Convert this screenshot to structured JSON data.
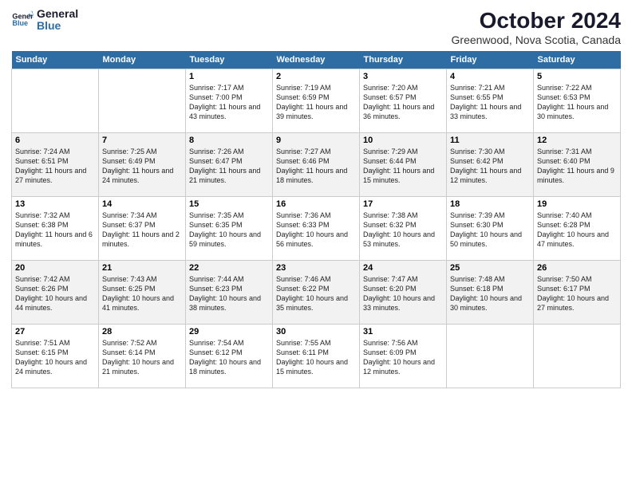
{
  "header": {
    "logo_line1": "General",
    "logo_line2": "Blue",
    "month": "October 2024",
    "location": "Greenwood, Nova Scotia, Canada"
  },
  "weekdays": [
    "Sunday",
    "Monday",
    "Tuesday",
    "Wednesday",
    "Thursday",
    "Friday",
    "Saturday"
  ],
  "weeks": [
    [
      {
        "day": "",
        "info": ""
      },
      {
        "day": "",
        "info": ""
      },
      {
        "day": "1",
        "info": "Sunrise: 7:17 AM\nSunset: 7:00 PM\nDaylight: 11 hours and 43 minutes."
      },
      {
        "day": "2",
        "info": "Sunrise: 7:19 AM\nSunset: 6:59 PM\nDaylight: 11 hours and 39 minutes."
      },
      {
        "day": "3",
        "info": "Sunrise: 7:20 AM\nSunset: 6:57 PM\nDaylight: 11 hours and 36 minutes."
      },
      {
        "day": "4",
        "info": "Sunrise: 7:21 AM\nSunset: 6:55 PM\nDaylight: 11 hours and 33 minutes."
      },
      {
        "day": "5",
        "info": "Sunrise: 7:22 AM\nSunset: 6:53 PM\nDaylight: 11 hours and 30 minutes."
      }
    ],
    [
      {
        "day": "6",
        "info": "Sunrise: 7:24 AM\nSunset: 6:51 PM\nDaylight: 11 hours and 27 minutes."
      },
      {
        "day": "7",
        "info": "Sunrise: 7:25 AM\nSunset: 6:49 PM\nDaylight: 11 hours and 24 minutes."
      },
      {
        "day": "8",
        "info": "Sunrise: 7:26 AM\nSunset: 6:47 PM\nDaylight: 11 hours and 21 minutes."
      },
      {
        "day": "9",
        "info": "Sunrise: 7:27 AM\nSunset: 6:46 PM\nDaylight: 11 hours and 18 minutes."
      },
      {
        "day": "10",
        "info": "Sunrise: 7:29 AM\nSunset: 6:44 PM\nDaylight: 11 hours and 15 minutes."
      },
      {
        "day": "11",
        "info": "Sunrise: 7:30 AM\nSunset: 6:42 PM\nDaylight: 11 hours and 12 minutes."
      },
      {
        "day": "12",
        "info": "Sunrise: 7:31 AM\nSunset: 6:40 PM\nDaylight: 11 hours and 9 minutes."
      }
    ],
    [
      {
        "day": "13",
        "info": "Sunrise: 7:32 AM\nSunset: 6:38 PM\nDaylight: 11 hours and 6 minutes."
      },
      {
        "day": "14",
        "info": "Sunrise: 7:34 AM\nSunset: 6:37 PM\nDaylight: 11 hours and 2 minutes."
      },
      {
        "day": "15",
        "info": "Sunrise: 7:35 AM\nSunset: 6:35 PM\nDaylight: 10 hours and 59 minutes."
      },
      {
        "day": "16",
        "info": "Sunrise: 7:36 AM\nSunset: 6:33 PM\nDaylight: 10 hours and 56 minutes."
      },
      {
        "day": "17",
        "info": "Sunrise: 7:38 AM\nSunset: 6:32 PM\nDaylight: 10 hours and 53 minutes."
      },
      {
        "day": "18",
        "info": "Sunrise: 7:39 AM\nSunset: 6:30 PM\nDaylight: 10 hours and 50 minutes."
      },
      {
        "day": "19",
        "info": "Sunrise: 7:40 AM\nSunset: 6:28 PM\nDaylight: 10 hours and 47 minutes."
      }
    ],
    [
      {
        "day": "20",
        "info": "Sunrise: 7:42 AM\nSunset: 6:26 PM\nDaylight: 10 hours and 44 minutes."
      },
      {
        "day": "21",
        "info": "Sunrise: 7:43 AM\nSunset: 6:25 PM\nDaylight: 10 hours and 41 minutes."
      },
      {
        "day": "22",
        "info": "Sunrise: 7:44 AM\nSunset: 6:23 PM\nDaylight: 10 hours and 38 minutes."
      },
      {
        "day": "23",
        "info": "Sunrise: 7:46 AM\nSunset: 6:22 PM\nDaylight: 10 hours and 35 minutes."
      },
      {
        "day": "24",
        "info": "Sunrise: 7:47 AM\nSunset: 6:20 PM\nDaylight: 10 hours and 33 minutes."
      },
      {
        "day": "25",
        "info": "Sunrise: 7:48 AM\nSunset: 6:18 PM\nDaylight: 10 hours and 30 minutes."
      },
      {
        "day": "26",
        "info": "Sunrise: 7:50 AM\nSunset: 6:17 PM\nDaylight: 10 hours and 27 minutes."
      }
    ],
    [
      {
        "day": "27",
        "info": "Sunrise: 7:51 AM\nSunset: 6:15 PM\nDaylight: 10 hours and 24 minutes."
      },
      {
        "day": "28",
        "info": "Sunrise: 7:52 AM\nSunset: 6:14 PM\nDaylight: 10 hours and 21 minutes."
      },
      {
        "day": "29",
        "info": "Sunrise: 7:54 AM\nSunset: 6:12 PM\nDaylight: 10 hours and 18 minutes."
      },
      {
        "day": "30",
        "info": "Sunrise: 7:55 AM\nSunset: 6:11 PM\nDaylight: 10 hours and 15 minutes."
      },
      {
        "day": "31",
        "info": "Sunrise: 7:56 AM\nSunset: 6:09 PM\nDaylight: 10 hours and 12 minutes."
      },
      {
        "day": "",
        "info": ""
      },
      {
        "day": "",
        "info": ""
      }
    ]
  ]
}
